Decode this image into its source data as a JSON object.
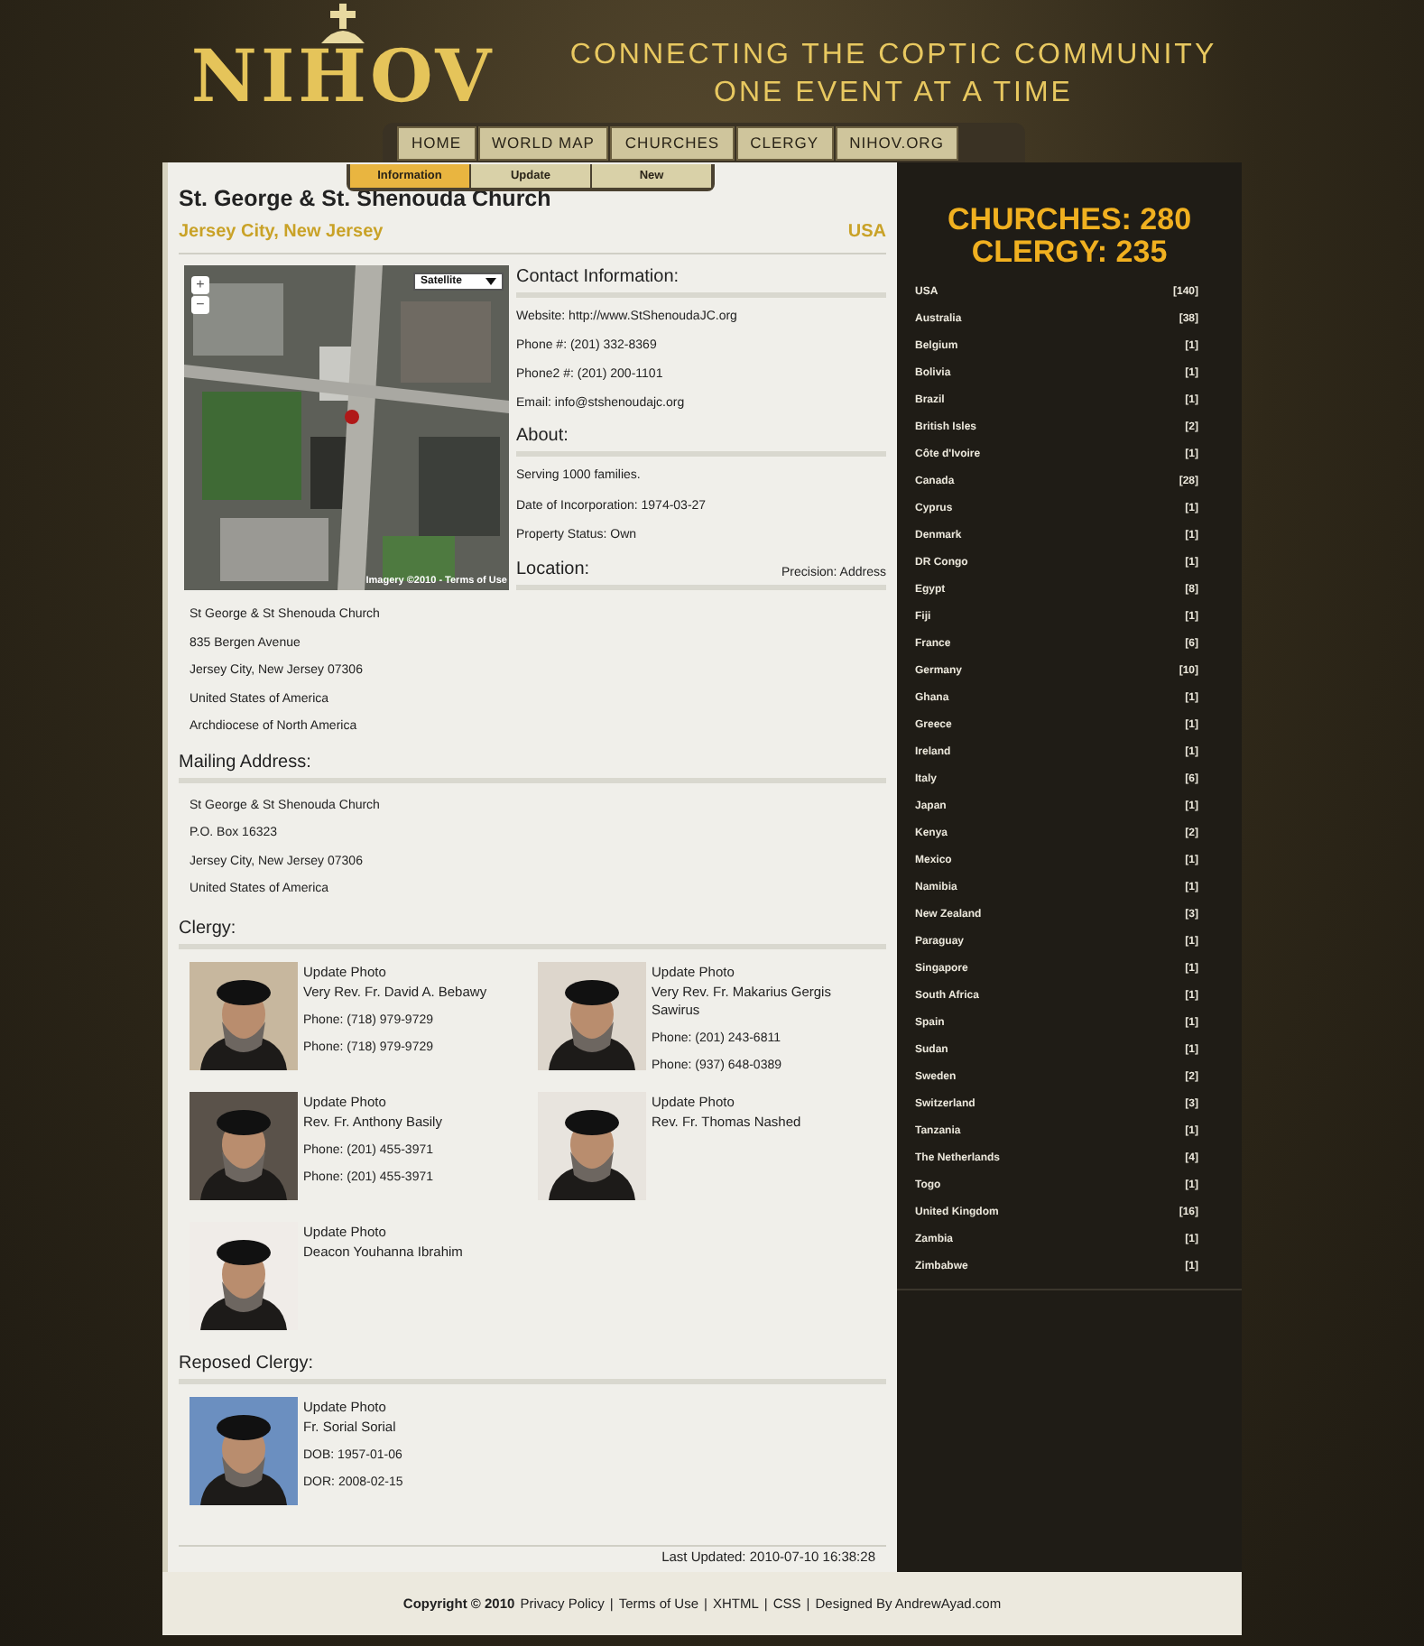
{
  "logo": {
    "text": "NIHOV"
  },
  "tagline": [
    "CONNECTING THE COPTIC COMMUNITY",
    "ONE EVENT AT A TIME"
  ],
  "nav": [
    {
      "label": "HOME",
      "selected": false
    },
    {
      "label": "WORLD MAP",
      "selected": false
    },
    {
      "label": "CHURCHES",
      "selected": false
    },
    {
      "label": "CLERGY",
      "selected": false
    },
    {
      "label": "NIHOV.ORG",
      "selected": false
    }
  ],
  "subtabs": [
    {
      "label": "Information",
      "selected": true
    },
    {
      "label": "Update",
      "selected": false
    },
    {
      "label": "New",
      "selected": false
    }
  ],
  "church": {
    "name": "St. George & St. Shenouda Church",
    "city": "Jersey City, New Jersey",
    "country": "USA"
  },
  "map": {
    "zoom_in": "+",
    "zoom_out": "−",
    "map_type": "Satellite",
    "attribution": "Imagery ©2010 - Terms of Use"
  },
  "contact": {
    "heading": "Contact Information:",
    "lines": [
      "Website: http://www.StShenoudaJC.org",
      "Phone #: (201) 332-8369",
      "Phone2 #: (201) 200-1101",
      "Email: info@stshenoudajc.org"
    ]
  },
  "about": {
    "heading": "About:",
    "lines": [
      "Serving 1000 families.",
      "Date of Incorporation: 1974-03-27",
      "Property Status: Own"
    ]
  },
  "location": {
    "heading": "Location:",
    "precision": "Precision: Address",
    "lines": [
      "St George & St Shenouda Church",
      "835 Bergen Avenue",
      "Jersey City, New Jersey 07306",
      "United States of America",
      "Archdiocese of North America"
    ]
  },
  "mailing": {
    "heading": "Mailing Address:",
    "lines": [
      "St George & St Shenouda Church",
      "P.O. Box 16323",
      "Jersey City, New Jersey 07306",
      "United States of America"
    ]
  },
  "clergy": {
    "heading": "Clergy:",
    "people": [
      {
        "update": "Update Photo",
        "name": "Very Rev. Fr. David A. Bebawy",
        "lines": [
          "Phone: (718) 979-9729",
          "Phone: (718) 979-9729"
        ]
      },
      {
        "update": "Update Photo",
        "name": "Very Rev. Fr. Makarius Gergis Sawirus",
        "lines": [
          "Phone: (201) 243-6811",
          "Phone: (937) 648-0389"
        ]
      },
      {
        "update": "Update Photo",
        "name": "Rev. Fr. Anthony Basily",
        "lines": [
          "Phone: (201) 455-3971",
          "Phone: (201) 455-3971"
        ]
      },
      {
        "update": "Update Photo",
        "name": "Rev. Fr. Thomas Nashed"
      },
      {
        "update": "Update Photo",
        "name": "Deacon Youhanna Ibrahim"
      }
    ]
  },
  "reposed": {
    "heading": "Reposed Clergy:",
    "people": [
      {
        "update": "Update Photo",
        "name": "Fr. Sorial Sorial",
        "lines": [
          "DOB: 1957-01-06",
          "DOR: 2008-02-15"
        ]
      }
    ]
  },
  "last_updated": "Last Updated: 2010-07-10 16:38:28",
  "stats": [
    "CHURCHES: 280",
    "CLERGY: 235"
  ],
  "countries": [
    {
      "name": "USA",
      "count": "[140]"
    },
    {
      "name": "Australia",
      "count": "[38]"
    },
    {
      "name": "Belgium",
      "count": "[1]"
    },
    {
      "name": "Bolivia",
      "count": "[1]"
    },
    {
      "name": "Brazil",
      "count": "[1]"
    },
    {
      "name": "British Isles",
      "count": "[2]"
    },
    {
      "name": "Côte d'Ivoire",
      "count": "[1]"
    },
    {
      "name": "Canada",
      "count": "[28]"
    },
    {
      "name": "Cyprus",
      "count": "[1]"
    },
    {
      "name": "Denmark",
      "count": "[1]"
    },
    {
      "name": "DR Congo",
      "count": "[1]"
    },
    {
      "name": "Egypt",
      "count": "[8]"
    },
    {
      "name": "Fiji",
      "count": "[1]"
    },
    {
      "name": "France",
      "count": "[6]"
    },
    {
      "name": "Germany",
      "count": "[10]"
    },
    {
      "name": "Ghana",
      "count": "[1]"
    },
    {
      "name": "Greece",
      "count": "[1]"
    },
    {
      "name": "Ireland",
      "count": "[1]"
    },
    {
      "name": "Italy",
      "count": "[6]"
    },
    {
      "name": "Japan",
      "count": "[1]"
    },
    {
      "name": "Kenya",
      "count": "[2]"
    },
    {
      "name": "Mexico",
      "count": "[1]"
    },
    {
      "name": "Namibia",
      "count": "[1]"
    },
    {
      "name": "New Zealand",
      "count": "[3]"
    },
    {
      "name": "Paraguay",
      "count": "[1]"
    },
    {
      "name": "Singapore",
      "count": "[1]"
    },
    {
      "name": "South Africa",
      "count": "[1]"
    },
    {
      "name": "Spain",
      "count": "[1]"
    },
    {
      "name": "Sudan",
      "count": "[1]"
    },
    {
      "name": "Sweden",
      "count": "[2]"
    },
    {
      "name": "Switzerland",
      "count": "[3]"
    },
    {
      "name": "Tanzania",
      "count": "[1]"
    },
    {
      "name": "The Netherlands",
      "count": "[4]"
    },
    {
      "name": "Togo",
      "count": "[1]"
    },
    {
      "name": "United Kingdom",
      "count": "[16]"
    },
    {
      "name": "Zambia",
      "count": "[1]"
    },
    {
      "name": "Zimbabwe",
      "count": "[1]"
    }
  ],
  "footer": {
    "copyright": "Copyright © 2010",
    "separator": "|",
    "links": [
      "Privacy Policy",
      "Terms of Use",
      "XHTML",
      "CSS",
      "Designed By AndrewAyad.com"
    ]
  }
}
